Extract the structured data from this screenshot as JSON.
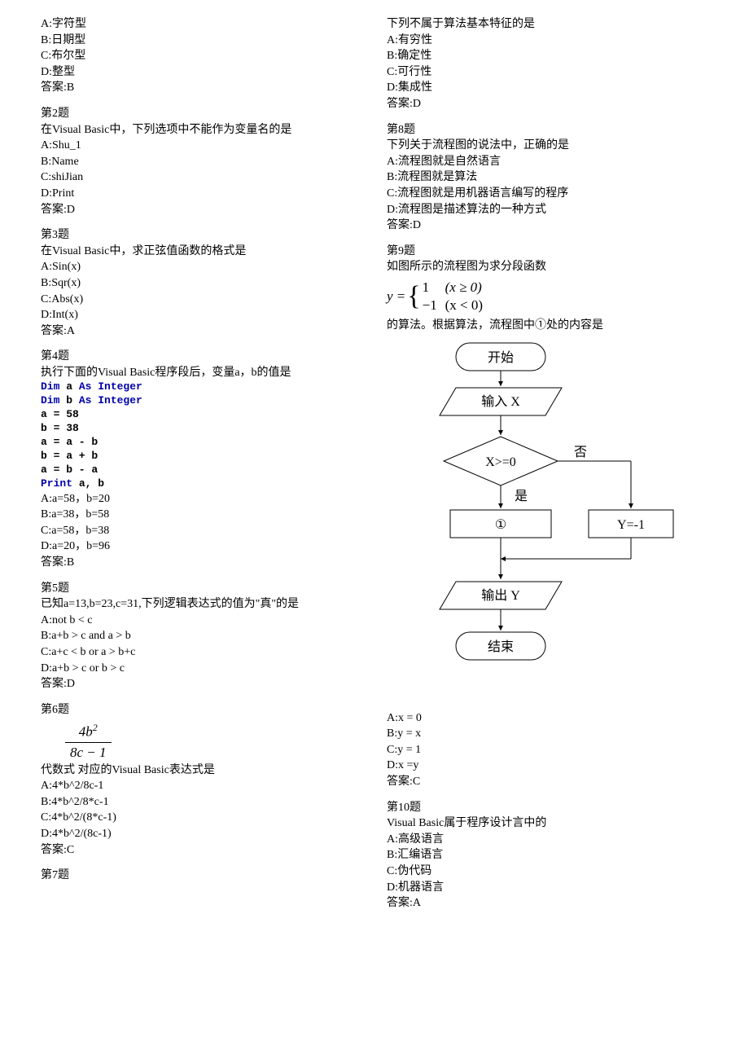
{
  "q1": {
    "A": "A:字符型",
    "B": "B:日期型",
    "C": "C:布尔型",
    "D": "D:整型",
    "ans": "答案:B"
  },
  "q2": {
    "title": "第2题",
    "stem": "在Visual Basic中，下列选项中不能作为变量名的是",
    "A": "A:Shu_1",
    "B": "B:Name",
    "C": "C:shiJian",
    "D": "D:Print",
    "ans": "答案:D"
  },
  "q3": {
    "title": "第3题",
    "stem": "在Visual Basic中，求正弦值函数的格式是",
    "A": "A:Sin(x)",
    "B": "B:Sqr(x)",
    "C": "C:Abs(x)",
    "D": "D:Int(x)",
    "ans": "答案:A"
  },
  "q4": {
    "title": "第4题",
    "stem": "执行下面的Visual Basic程序段后，变量a，b的值是",
    "code": {
      "l1a": "Dim",
      "l1b": " a ",
      "l1c": "As Integer",
      "l2a": "Dim",
      "l2b": " b ",
      "l2c": "As Integer",
      "l3": "a = 58",
      "l4": "b = 38",
      "l5": "a = a - b",
      "l6": "b = a + b",
      "l7": "a = b - a",
      "l8a": "Print",
      "l8b": " a, b"
    },
    "A": "A:a=58，b=20",
    "B": "B:a=38，b=58",
    "C": "C:a=58，b=38",
    "D": "D:a=20，b=96",
    "ans": "答案:B"
  },
  "q5": {
    "title": "第5题",
    "stem": "已知a=13,b=23,c=31,下列逻辑表达式的值为\"真\"的是",
    "A": "A:not b < c",
    "B": "B:a+b > c and a > b",
    "C": "C:a+c < b or a > b+c",
    "D": "D:a+b > c or b > c",
    "ans": "答案:D"
  },
  "q6": {
    "title": "第6题",
    "stem_pre": "代数式",
    "frac_num": "4b",
    "frac_den": "8c − 1",
    "stem_post": "对应的Visual Basic表达式是",
    "A": "A:4*b^2/8c-1",
    "B": "B:4*b^2/8*c-1",
    "C": "C:4*b^2/(8*c-1)",
    "D": "D:4*b^2/(8c-1)",
    "ans": "答案:C"
  },
  "q7": {
    "title": "第7题",
    "stem": "下列不属于算法基本特征的是",
    "A": "A:有穷性",
    "B": "B:确定性",
    "C": "C:可行性",
    "D": "D:集成性",
    "ans": "答案:D"
  },
  "q8": {
    "title": "第8题",
    "stem": "下列关于流程图的说法中，正确的是",
    "A": "A:流程图就是自然语言",
    "B": "B:流程图就是算法",
    "C": "C:流程图就是用机器语言编写的程序",
    "D": "D:流程图是描述算法的一种方式",
    "ans": "答案:D"
  },
  "q9": {
    "title": "第9题",
    "stem1": "如图所示的流程图为求分段函数",
    "pw_y": "y =",
    "pw_c1": "1",
    "pw_c1r": "(x ≥ 0)",
    "pw_c2": "−1",
    "pw_c2r": "(x < 0)",
    "stem2": "的算法。根据算法，流程图中①处的内容是",
    "flow": {
      "start": "开始",
      "input": "输入 X",
      "cond": "X>=0",
      "yes": "是",
      "no": "否",
      "box1": "①",
      "box2": "Y=-1",
      "output": "输出 Y",
      "end": "结束"
    },
    "A": "A:x = 0",
    "B": "B:y = x",
    "C": "C:y = 1",
    "D": "D:x =y",
    "ans": "答案:C"
  },
  "q10": {
    "title": "第10题",
    "stem": "Visual Basic属于程序设计言中的",
    "A": "A:高级语言",
    "B": "B:汇编语言",
    "C": "C:伪代码",
    "D": "D:机器语言",
    "ans": "答案:A"
  }
}
